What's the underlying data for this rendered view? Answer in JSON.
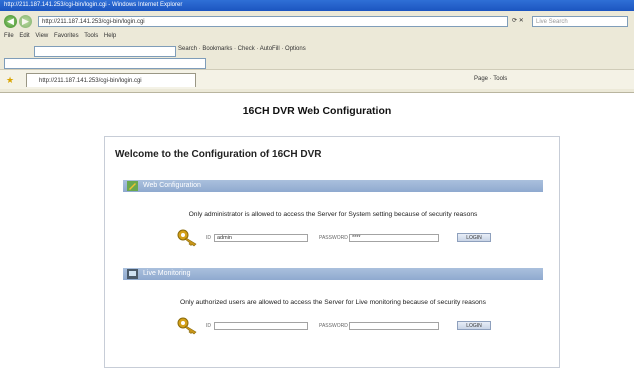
{
  "window": {
    "title": "http://211.187.141.253/cgi-bin/login.cgi - Windows Internet Explorer"
  },
  "browser": {
    "address": "http://211.187.141.253/cgi-bin/login.cgi",
    "search_placeholder": "Live Search",
    "menu": [
      "File",
      "Edit",
      "View",
      "Favorites",
      "Tools",
      "Help"
    ],
    "toolbar_text": "Search · Bookmarks · Check · AutoFill · Options",
    "tab_label": "http://211.187.141.253/cgi-bin/login.cgi",
    "tab_tools": "Page · Tools"
  },
  "page": {
    "title": "16CH DVR Web Configuration",
    "welcome": "Welcome to the Configuration of 16CH DVR",
    "web_config": {
      "heading": "Web Configuration",
      "description": "Only administrator is allowed to access the Server for System setting because of security reasons",
      "id_label": "ID",
      "id_value": "admin",
      "password_label": "PASSWORD",
      "password_value": "****",
      "login_label": "LOGIN"
    },
    "live_monitoring": {
      "heading": "Live Monitoring",
      "description": "Only authorized users are allowed to access the Server for Live monitoring because of security reasons",
      "id_label": "ID",
      "id_value": "",
      "password_label": "PASSWORD",
      "password_value": "",
      "login_label": "LOGIN"
    }
  }
}
